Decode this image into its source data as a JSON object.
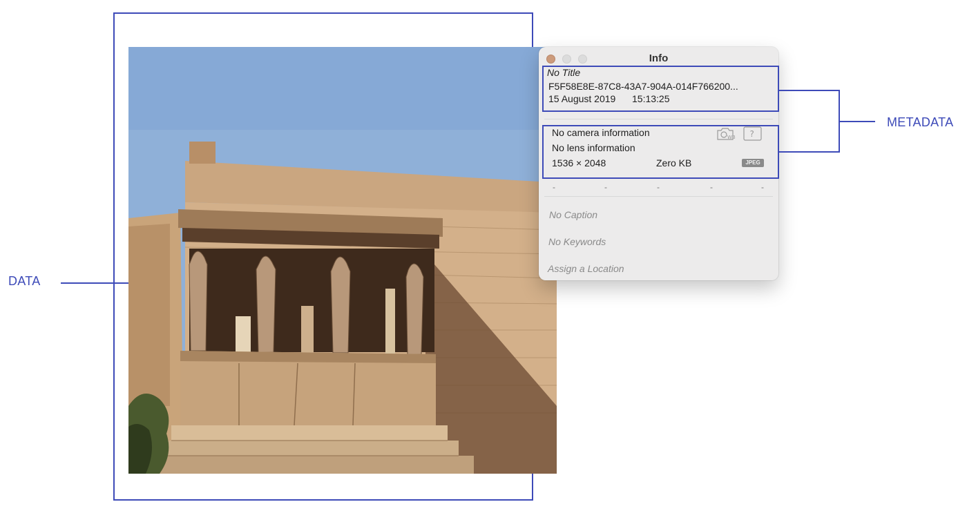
{
  "annotations": {
    "data_label": "DATA",
    "metadata_label": "METADATA",
    "accent_color": "#3d4ab8"
  },
  "photo": {
    "subject_icon": "photo-caryatid-porch"
  },
  "info_window": {
    "title": "Info",
    "title_field": "No Title",
    "filename": "F5F58E8E-87C8-43A7-904A-014F766200...",
    "date": "15 August 2019",
    "time": "15:13:25",
    "camera": "No camera information",
    "lens": "No lens information",
    "dimensions": "1536 × 2048",
    "size": "Zero KB",
    "format": "JPEG",
    "exif_dashes": [
      "-",
      "-",
      "-",
      "-",
      "-"
    ],
    "caption_placeholder": "No Caption",
    "keywords_placeholder": "No Keywords",
    "location_placeholder": "Assign a Location",
    "icons": [
      "white-balance-icon",
      "help-icon"
    ]
  }
}
